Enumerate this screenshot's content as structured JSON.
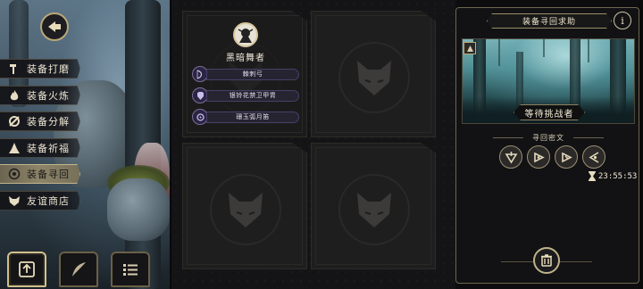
{
  "navigation": {
    "back_icon": "back-arrow-icon"
  },
  "menu": {
    "items": [
      {
        "label": "装备打磨",
        "icon": "hammer-icon",
        "active": false
      },
      {
        "label": "装备火炼",
        "icon": "flame-icon",
        "active": false
      },
      {
        "label": "装备分解",
        "icon": "gear-break-icon",
        "active": false
      },
      {
        "label": "装备祈福",
        "icon": "pray-icon",
        "active": false
      },
      {
        "label": "装备寻回",
        "icon": "target-icon",
        "active": true
      },
      {
        "label": "友谊商店",
        "icon": "fox-shop-icon",
        "active": false
      }
    ]
  },
  "bottom_nav": [
    {
      "name": "upload-button",
      "icon": "upload-icon",
      "active": true
    },
    {
      "name": "quill-button",
      "icon": "quill-icon",
      "active": false
    },
    {
      "name": "list-button",
      "icon": "list-icon",
      "active": false
    }
  ],
  "slots": {
    "filled": {
      "character_name": "黑暗舞者",
      "equipment": [
        {
          "label": "棘刺弓",
          "icon": "bow-icon"
        },
        {
          "label": "银铃花禁卫甲胄",
          "icon": "armor-icon"
        },
        {
          "label": "珊玉弧月笛",
          "icon": "flute-icon"
        }
      ]
    },
    "empty_count": 3
  },
  "right_panel": {
    "title": "装备寻回求助",
    "info_label": "i",
    "state_label": "等待挑战者",
    "rune_title": "寻回密文",
    "runes": [
      "rune-1-icon",
      "rune-2-icon",
      "rune-3-icon",
      "rune-4-icon"
    ],
    "timer": "23:55:53"
  },
  "colors": {
    "gold_border": "#b9a778",
    "active_menu": "#8d8468",
    "equip_purple": "#7a6d9a",
    "forest_teal": "#4f8d93"
  }
}
